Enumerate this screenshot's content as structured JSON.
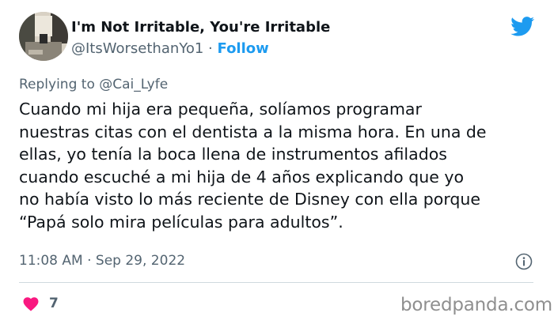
{
  "author": {
    "display_name": "I'm Not Irritable, You're Irritable",
    "handle": "@ItsWorsethanYo1",
    "separator": " · ",
    "follow_label": "Follow"
  },
  "reply": {
    "prefix": "Replying to ",
    "mention": "@Cai_Lyfe"
  },
  "tweet": {
    "text": "Cuando mi hija era pequeña, solíamos programar\nnuestras citas con el dentista a la misma hora. En una de\nellas, yo tenía la boca llena de instrumentos afilados\ncuando escuché a mi hija de 4 años explicando que yo\nno había visto lo más reciente de Disney con ella porque\n“Papá solo mira películas para adultos”.",
    "time": "11:08 AM",
    "separator": " · ",
    "date": "Sep 29, 2022"
  },
  "engagement": {
    "like_count": "7"
  },
  "watermark": "boredpanda.com",
  "colors": {
    "twitter_blue": "#1d9bf0",
    "heart_pink": "#f91880",
    "muted_text": "#536471"
  },
  "icons": {
    "brand": "twitter-bird-icon",
    "info": "info-icon",
    "like": "heart-icon"
  }
}
